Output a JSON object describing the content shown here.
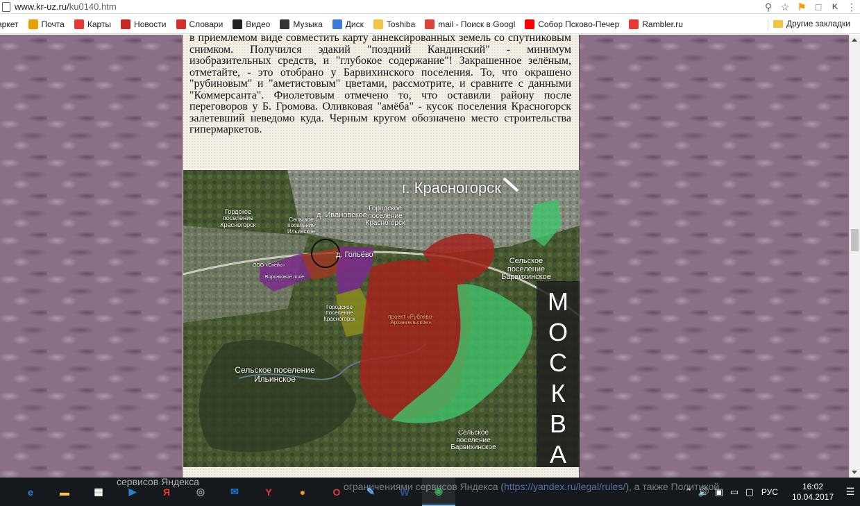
{
  "browser": {
    "url_host": "www.kr-uz.ru/",
    "url_path": "ku0140.htm",
    "icons": [
      "search-icon",
      "star-icon",
      "yandex-flag-icon",
      "extension-icon",
      "k-extension-icon",
      "menu-icon"
    ]
  },
  "bookmarks": [
    {
      "label": "аркет",
      "icon": "market-icon",
      "color": "#ff3333"
    },
    {
      "label": "Почта",
      "icon": "mail-icon",
      "color": "#e8a000"
    },
    {
      "label": "Карты",
      "icon": "map-pin-icon",
      "color": "#e53935"
    },
    {
      "label": "Новости",
      "icon": "news-icon",
      "color": "#c62828"
    },
    {
      "label": "Словари",
      "icon": "dictionary-icon",
      "color": "#d32f2f"
    },
    {
      "label": "Видео",
      "icon": "video-icon",
      "color": "#222222"
    },
    {
      "label": "Музыка",
      "icon": "music-icon",
      "color": "#333333"
    },
    {
      "label": "Диск",
      "icon": "disk-icon",
      "color": "#3b7dd8"
    },
    {
      "label": "Toshiba",
      "icon": "folder-icon",
      "color": "#f4c542"
    },
    {
      "label": "mail - Поиск в Googl",
      "icon": "google-icon",
      "color": "#db4437"
    },
    {
      "label": "Собор Псково-Печер",
      "icon": "yandex-icon",
      "color": "#ff0000"
    },
    {
      "label": "Rambler.ru",
      "icon": "rambler-icon",
      "color": "#e53935"
    }
  ],
  "bookmarks_other": "Другие закладки",
  "article": {
    "paragraph": "в приемлемом виде совместить карту аннексированных земель со спутниковым снимком. Получился эдакий \"поздний Кандинский\" - минимум изобразительных средств, и \"глубокое содержание\"! Закрашенное зелёным, отметайте, - это отобрано у Барвихинского поселения. То, что окрашено \"рубиновым\" и \"аметистовым\" цветами, рассмотрите, и сравните с данными \"Коммерсанта\". Фиолетовым отмечено то, что оставили району после переговоров у Б. Громова. Оливковая \"амёба\" - кусок поселения Красногорск залетевший неведомо куда. Черным кругом обозначено место строительства гипермаркетов."
  },
  "map": {
    "labels": {
      "krasnogorsk_city": "г. Красногорск",
      "gp_krasnogorsk_left": "Гордское поселение Красногорск",
      "sp_ilinskoe_top": "Сельское поселение Ильинское",
      "ivanovskoe": "д. Ивановское",
      "gp_krasnogorsk_top": "Городское поселение Красногорск",
      "ooo_speis": "ООО «Спейс»",
      "voronkovo": "Воронковое поле",
      "golyevo": "д. Гольёво",
      "gp_krasnogorsk_mid": "Городское поселение Красногорск",
      "project": "проект «Рублево-Архангельское»",
      "sp_barvikha_right": "Сельское поселение Барвихинское",
      "sp_ilinskoe_bottom": "Сельское поселение Ильинское",
      "sp_barvikha_bottom": "Сельское поселение Барвихинское",
      "moskva_letters": [
        "М",
        "О",
        "С",
        "К",
        "В",
        "А"
      ]
    },
    "colors": {
      "ruby": "#a3231c",
      "amethyst": "#7a2d8c",
      "green": "#3fc46a",
      "olive": "#8a8c1e",
      "rust": "#9a3a1f"
    }
  },
  "taskbar": {
    "ghost_text": "сервисов Яндекса",
    "ghost_text2_a": "ограничениями",
    "ghost_text2_b": "сервисов Яндекса (",
    "ghost_link": "https://yandex.ru/legal/rules/",
    "ghost_text2_c": "), а также Политикой",
    "apps": [
      {
        "name": "edge-icon",
        "glyph": "e",
        "color": "#1e88e5"
      },
      {
        "name": "file-explorer-icon",
        "glyph": "▬",
        "color": "#f6c244"
      },
      {
        "name": "store-icon",
        "glyph": "▦",
        "color": "#ffffff"
      },
      {
        "name": "media-player-icon",
        "glyph": "▶",
        "color": "#2d7dd2"
      },
      {
        "name": "yandex-browser-icon",
        "glyph": "Я",
        "color": "#e53935"
      },
      {
        "name": "app-circle-icon",
        "glyph": "◎",
        "color": "#9e9e9e"
      },
      {
        "name": "mail-app-icon",
        "glyph": "✉",
        "color": "#1976d2"
      },
      {
        "name": "yandex-app-icon",
        "glyph": "Y",
        "color": "#e53935"
      },
      {
        "name": "odnoklassniki-icon",
        "glyph": "●",
        "color": "#f7931e"
      },
      {
        "name": "opera-icon",
        "glyph": "O",
        "color": "#e53935"
      },
      {
        "name": "paint-icon",
        "glyph": "✎",
        "color": "#64b5f6"
      },
      {
        "name": "word-icon",
        "glyph": "W",
        "color": "#2b579a"
      },
      {
        "name": "chrome-icon",
        "glyph": "◉",
        "color": "#34a853"
      }
    ],
    "tray": {
      "lang": "РУС",
      "time": "16:02",
      "date": "10.04.2017"
    }
  }
}
